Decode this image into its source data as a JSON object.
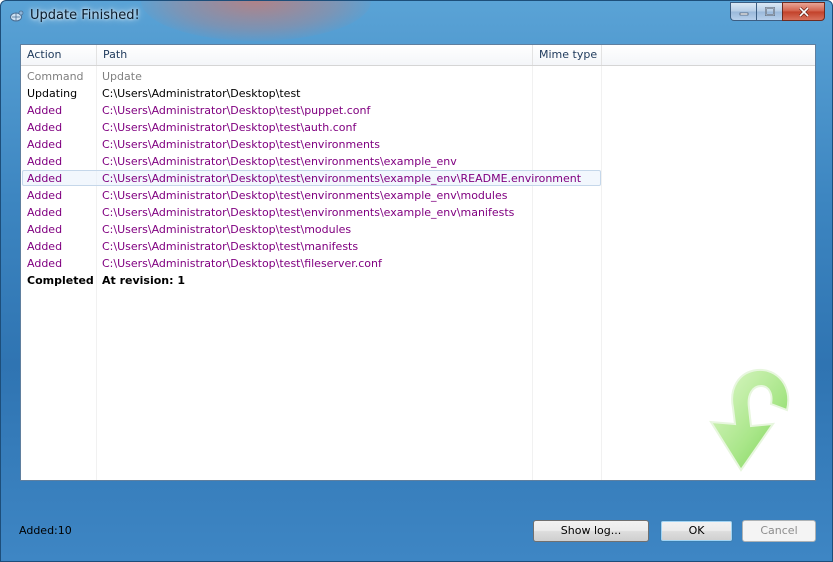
{
  "window": {
    "title": "Update Finished!"
  },
  "icons": {
    "title": "tortoise-app-icon",
    "minimize": "minimize-icon",
    "maximize": "maximize-icon",
    "close": "close-icon",
    "status": "update-arrow-icon"
  },
  "listview": {
    "columns": [
      "Action",
      "Path",
      "Mime type"
    ],
    "rows": [
      {
        "action": "Command",
        "path": "Update"
      },
      {
        "action": "Updating",
        "path": "C:\\Users\\Administrator\\Desktop\\test"
      },
      {
        "action": "Added",
        "path": "C:\\Users\\Administrator\\Desktop\\test\\puppet.conf"
      },
      {
        "action": "Added",
        "path": "C:\\Users\\Administrator\\Desktop\\test\\auth.conf"
      },
      {
        "action": "Added",
        "path": "C:\\Users\\Administrator\\Desktop\\test\\environments"
      },
      {
        "action": "Added",
        "path": "C:\\Users\\Administrator\\Desktop\\test\\environments\\example_env"
      },
      {
        "action": "Added",
        "path": "C:\\Users\\Administrator\\Desktop\\test\\environments\\example_env\\README.environment"
      },
      {
        "action": "Added",
        "path": "C:\\Users\\Administrator\\Desktop\\test\\environments\\example_env\\modules"
      },
      {
        "action": "Added",
        "path": "C:\\Users\\Administrator\\Desktop\\test\\environments\\example_env\\manifests"
      },
      {
        "action": "Added",
        "path": "C:\\Users\\Administrator\\Desktop\\test\\modules"
      },
      {
        "action": "Added",
        "path": "C:\\Users\\Administrator\\Desktop\\test\\manifests"
      },
      {
        "action": "Added",
        "path": "C:\\Users\\Administrator\\Desktop\\test\\fileserver.conf"
      },
      {
        "action": "Completed",
        "path": "At revision: 1"
      }
    ]
  },
  "status": {
    "text": "Added:10"
  },
  "buttons": {
    "show_log": "Show log...",
    "ok": "OK",
    "cancel": "Cancel"
  },
  "colors": {
    "added_text": "#800080",
    "command_text": "#808080",
    "arrow_green": "#7ed957"
  }
}
